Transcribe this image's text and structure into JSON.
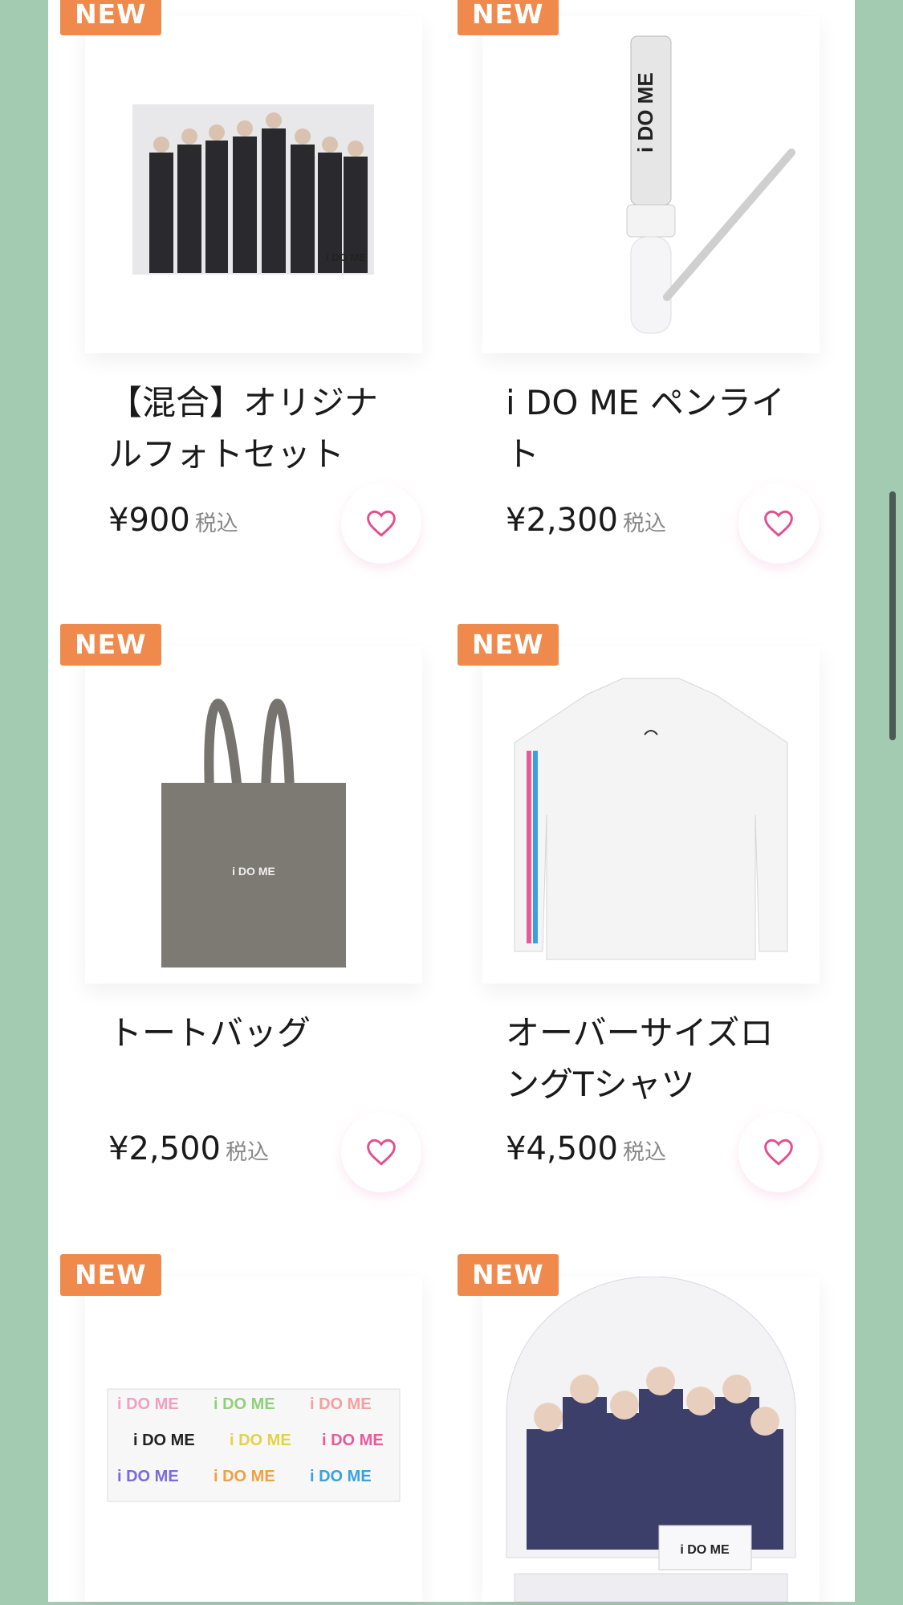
{
  "products": [
    {
      "badge": "NEW",
      "title": "【混合】オリジナルフォトセット",
      "price": "¥900",
      "tax": "税込",
      "photo_text": "i DO ME"
    },
    {
      "badge": "NEW",
      "title": "i DO ME ペンライト",
      "price": "¥2,300",
      "tax": "税込",
      "photo_text": "i DO ME"
    },
    {
      "badge": "NEW",
      "title": "トートバッグ",
      "price": "¥2,500",
      "tax": "税込",
      "photo_text": "i DO ME"
    },
    {
      "badge": "NEW",
      "title": "オーバーサイズロングTシャツ",
      "price": "¥4,500",
      "tax": "税込",
      "photo_text": ""
    },
    {
      "badge": "NEW",
      "title": "",
      "price": "",
      "tax": "",
      "photo_text": "i DO ME"
    },
    {
      "badge": "NEW",
      "title": "",
      "price": "",
      "tax": "",
      "photo_text": "i DO ME"
    }
  ],
  "colors": {
    "background": "#a3cbb2",
    "badge": "#ef8a4c",
    "heart": "#e24f8f"
  },
  "icons": {
    "favorite": "heart-outline-icon"
  }
}
